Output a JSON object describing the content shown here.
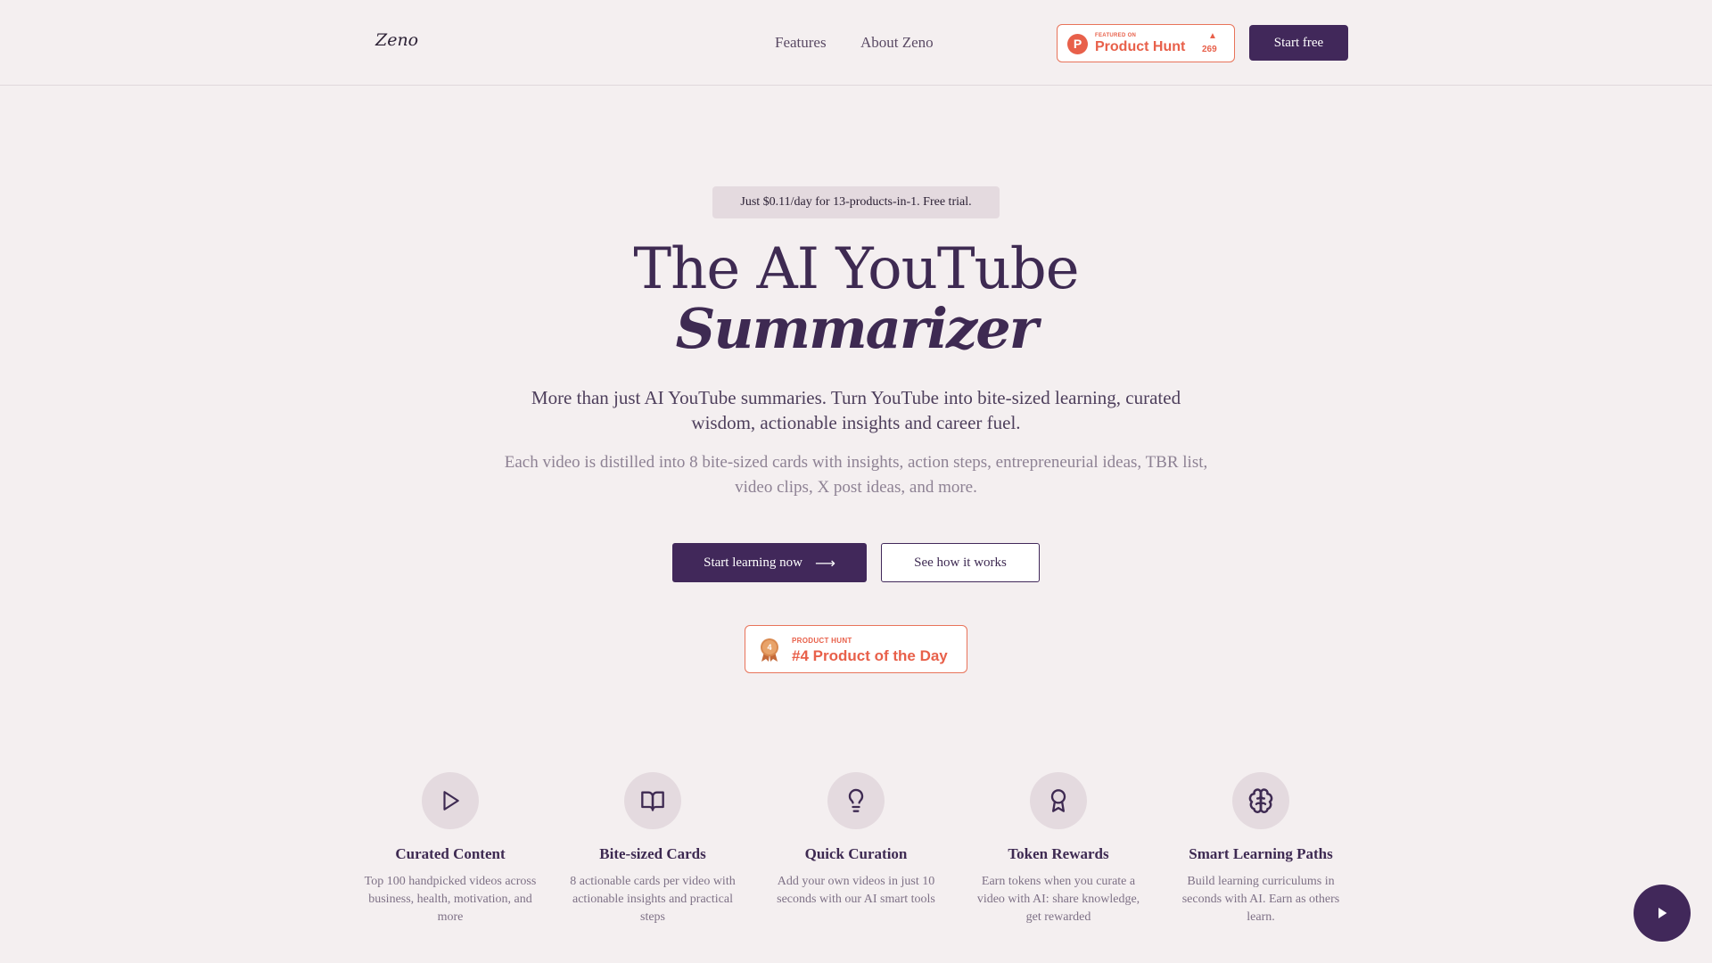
{
  "header": {
    "logo": "Zeno",
    "nav": [
      {
        "label": "Features"
      },
      {
        "label": "About Zeno"
      }
    ],
    "product_hunt_badge": {
      "logo_letter": "P",
      "small_text": "FEATURED ON",
      "name": "Product Hunt",
      "arrow": "▲",
      "upvotes": "269"
    },
    "start_free_label": "Start free"
  },
  "hero": {
    "pill": "Just $0.11/day for 13-products-in-1. Free trial.",
    "title_line1": "The AI YouTube",
    "title_line2": "Summarizer",
    "subtitle": "More than just AI YouTube summaries. Turn YouTube into bite-sized learning, curated wisdom, actionable insights and career fuel.",
    "description": "Each video is distilled into 8 bite-sized cards with insights, action steps, entrepreneurial ideas, TBR list, video clips, X post ideas, and more.",
    "primary_cta": "Start learning now",
    "primary_cta_arrow": "⟶",
    "secondary_cta": "See how it works",
    "award": {
      "medal_number": "4",
      "small_text": "PRODUCT HUNT",
      "big_text": "#4 Product of the Day"
    }
  },
  "features": [
    {
      "icon": "play-icon",
      "title": "Curated Content",
      "description": "Top 100 handpicked videos across business, health, motivation, and more"
    },
    {
      "icon": "book-open-icon",
      "title": "Bite-sized Cards",
      "description": "8 actionable cards per video with actionable insights and practical steps"
    },
    {
      "icon": "lightbulb-icon",
      "title": "Quick Curation",
      "description": "Add your own videos in just 10 seconds with our AI smart tools"
    },
    {
      "icon": "award-icon",
      "title": "Token Rewards",
      "description": "Earn tokens when you curate a video with AI: share knowledge, get rewarded"
    },
    {
      "icon": "brain-icon",
      "title": "Smart Learning Paths",
      "description": "Build learning curriculums in seconds with AI. Earn as others learn."
    }
  ],
  "colors": {
    "background": "#f4eff0",
    "primary": "#41285a",
    "product_hunt": "#e8604a",
    "icon_circle": "#e4dadf"
  }
}
